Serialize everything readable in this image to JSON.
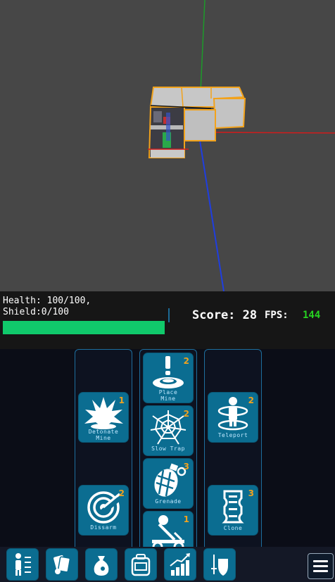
{
  "hud": {
    "health_text": "Health: 100/100,",
    "shield_text": "Shield:0/100",
    "health_fraction": 1.0,
    "score_text": "Score: 28",
    "fps_label": "FPS:",
    "fps_value": "144"
  },
  "abilities": [
    {
      "id": "detonate-mine",
      "label_line1": "Detonate",
      "label_line2": "Mine",
      "count": "1",
      "icon": "explosion-icon"
    },
    {
      "id": "disarm",
      "label_line1": "Dissarm",
      "label_line2": "",
      "count": "2",
      "icon": "radar-icon"
    },
    {
      "id": "place-mine",
      "label_line1": "Place",
      "label_line2": "Mine",
      "count": "2",
      "icon": "mine-icon"
    },
    {
      "id": "slow-trap",
      "label_line1": "Slow Trap",
      "label_line2": "",
      "count": "2",
      "icon": "spiderweb-icon"
    },
    {
      "id": "grenade",
      "label_line1": "Grenade",
      "label_line2": "",
      "count": "3",
      "icon": "grenade-icon"
    },
    {
      "id": "catapult",
      "label_line1": "",
      "label_line2": "",
      "count": "1",
      "icon": "catapult-icon"
    },
    {
      "id": "teleport",
      "label_line1": "Teleport",
      "label_line2": "",
      "count": "2",
      "icon": "teleport-icon"
    },
    {
      "id": "clone",
      "label_line1": "Clone",
      "label_line2": "",
      "count": "3",
      "icon": "clone-icon"
    }
  ],
  "toolbar": {
    "buttons": [
      "abilities-icon",
      "cards-icon",
      "money-bag-icon",
      "backpack-icon",
      "upgrade-stats-icon",
      "shield-sword-icon"
    ],
    "menu_icon": "hamburger-menu-icon"
  },
  "colors": {
    "ability_bg": "#0b6d91",
    "count": "#f0a21f",
    "health_fill": "#10c96b",
    "fps_value": "#27d321",
    "selection_outline": "#f2a21b"
  }
}
